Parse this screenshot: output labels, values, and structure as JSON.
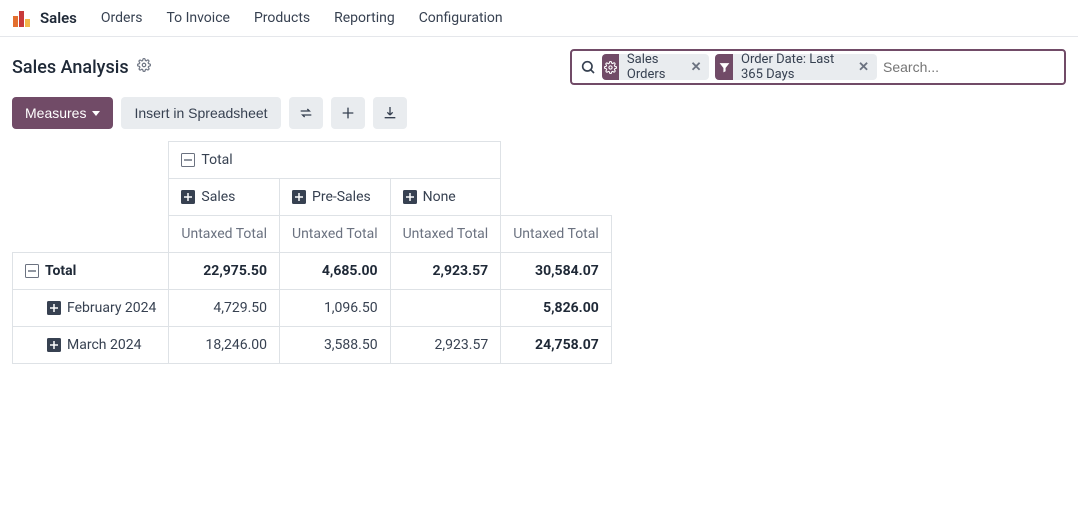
{
  "nav": {
    "app_name": "Sales",
    "items": [
      "Orders",
      "To Invoice",
      "Products",
      "Reporting",
      "Configuration"
    ]
  },
  "header": {
    "title": "Sales Analysis"
  },
  "search": {
    "placeholder": "Search...",
    "facets": [
      {
        "icon": "gear",
        "label": "Sales Orders"
      },
      {
        "icon": "filter",
        "label": "Order Date: Last 365 Days"
      }
    ]
  },
  "controls": {
    "measures_label": "Measures",
    "insert_label": "Insert in Spreadsheet"
  },
  "pivot": {
    "col_total_label": "Total",
    "col_groups": [
      "Sales",
      "Pre-Sales",
      "None"
    ],
    "measure_label": "Untaxed Total",
    "row_total_label": "Total",
    "rows": [
      {
        "label": "February 2024",
        "values": [
          "4,729.50",
          "1,096.50",
          ""
        ],
        "total": "5,826.00"
      },
      {
        "label": "March 2024",
        "values": [
          "18,246.00",
          "3,588.50",
          "2,923.57"
        ],
        "total": "24,758.07"
      }
    ],
    "totals": {
      "values": [
        "22,975.50",
        "4,685.00",
        "2,923.57"
      ],
      "grand": "30,584.07"
    }
  }
}
